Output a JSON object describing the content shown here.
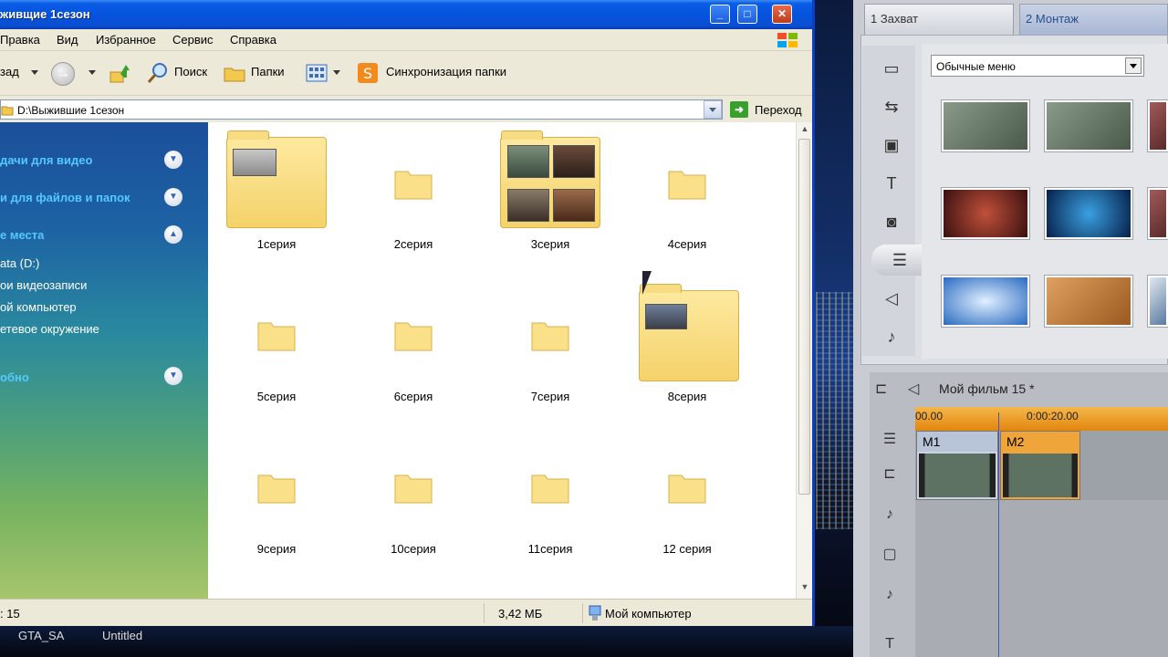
{
  "explorer": {
    "title": "живщие 1сезон",
    "menu": [
      "Правка",
      "Вид",
      "Избранное",
      "Сервис",
      "Справка"
    ],
    "toolbar": {
      "back_label": "зад",
      "search_label": "Поиск",
      "folders_label": "Папки",
      "sync_label": "Синхронизация папки"
    },
    "address": {
      "path": "D:\\Выжившие 1сезон",
      "go_label": "Переход"
    },
    "taskpane": {
      "sections": [
        {
          "label": "дачи для видео",
          "toggle": "▼"
        },
        {
          "label": "и для файлов и папок",
          "toggle": "▼"
        },
        {
          "label": "е места",
          "toggle": "▲"
        },
        {
          "label": "обно",
          "toggle": "▼"
        }
      ],
      "links": [
        "ata (D:)",
        "ои видеозаписи",
        "ой компьютер",
        "етевое окружение"
      ]
    },
    "folders": [
      "1серия",
      "2серия",
      "3серия",
      "4серия",
      "5серия",
      "6серия",
      "7серия",
      "8серия",
      "9серия",
      "10серия",
      "11серия",
      "12 серия"
    ],
    "status": {
      "count": ": 15",
      "size": "3,42 МБ",
      "location": "Мой компьютер"
    }
  },
  "taskbar": {
    "items": [
      "GTA_SA",
      "Untitled"
    ]
  },
  "pinnacle": {
    "tabs": [
      {
        "num": "1",
        "label": "Захват"
      },
      {
        "num": "2",
        "label": "Монтаж"
      }
    ],
    "menu_select": "Обычные меню",
    "sidebar_icons": [
      "video-camera-icon",
      "transitions-icon",
      "photo-icon",
      "title-icon",
      "frame-grab-icon",
      "disc-menu-icon",
      "sound-effects-icon",
      "music-icon"
    ],
    "project": {
      "title": "Мой фильм 15 *",
      "ruler_start": "00.00",
      "ruler_mark": "0:00:20.00",
      "clips": [
        "M1",
        "M2"
      ]
    }
  },
  "colors": {
    "xp_titlebar": "#0553dd",
    "timeline_ruler": "#e2860f",
    "clip_m2": "#f0a53a"
  }
}
